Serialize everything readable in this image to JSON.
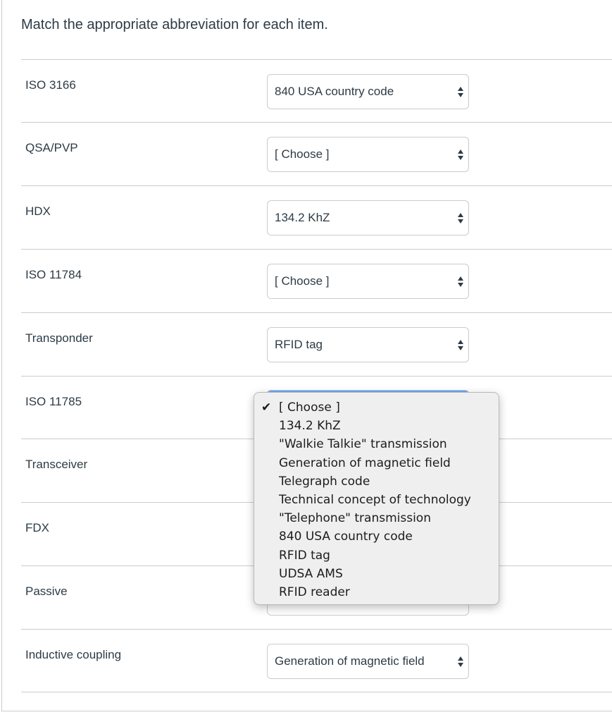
{
  "question": {
    "prompt": "Match the appropriate abbreviation for each item."
  },
  "rows": [
    {
      "label": "ISO 3166",
      "selected": "840 USA country code"
    },
    {
      "label": "QSA/PVP",
      "selected": "[ Choose ]"
    },
    {
      "label": "HDX",
      "selected": "134.2 KhZ"
    },
    {
      "label": "ISO 11784",
      "selected": "[ Choose ]"
    },
    {
      "label": "Transponder",
      "selected": "RFID tag"
    },
    {
      "label": "ISO 11785",
      "selected": ""
    },
    {
      "label": "Transceiver",
      "selected": ""
    },
    {
      "label": "FDX",
      "selected": ""
    },
    {
      "label": "Passive",
      "selected": ""
    },
    {
      "label": "Inductive coupling",
      "selected": "Generation of magnetic field"
    }
  ],
  "dropdown": {
    "checkmark": "✔",
    "options": [
      "[ Choose ]",
      "134.2 KhZ",
      "\"Walkie Talkie\" transmission",
      "Generation of magnetic field",
      "Telegraph code",
      "Technical concept of technology",
      "\"Telephone\" transmission",
      "840 USA country code",
      "RFID tag",
      "UDSA AMS",
      "RFID reader"
    ],
    "selected_index": 0
  },
  "colors": {
    "text": "#2d3b45",
    "border": "#c7cdd1",
    "focus": "#6ea6ee",
    "dropdown_bg": "#efefef"
  }
}
